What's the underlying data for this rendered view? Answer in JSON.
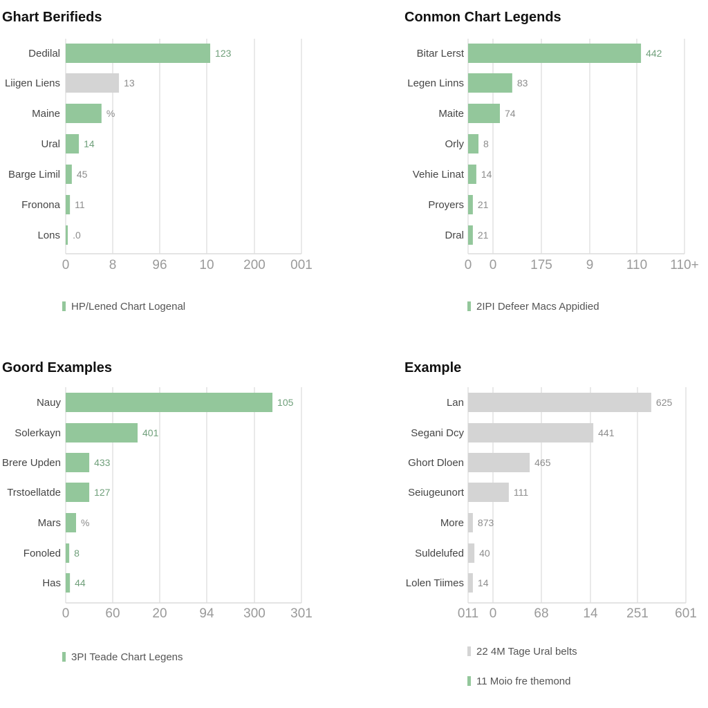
{
  "colors": {
    "green": "#93c79b",
    "grey": "#d4d4d4",
    "label_green": "#6f9f7a",
    "label_grey": "#8c8c8c"
  },
  "chart_data": [
    {
      "type": "bar",
      "orientation": "horizontal",
      "title": "Ghart Berifieds",
      "categories": [
        "Dedilal",
        "Liigen Liens",
        "Maine",
        "Ural",
        "Barge Limil",
        "Fronona",
        "Lons"
      ],
      "values": [
        0.613,
        0.226,
        0.152,
        0.056,
        0.026,
        0.018,
        0.009
      ],
      "value_units": "fraction of x-axis range",
      "data_labels": [
        "123",
        "13",
        "%",
        "14",
        "45",
        "11",
        ".0"
      ],
      "bar_colors": [
        "green",
        "grey",
        "green",
        "green",
        "green",
        "green",
        "green"
      ],
      "label_colors": [
        "green",
        "grey",
        "grey",
        "green",
        "grey",
        "grey",
        "grey"
      ],
      "xticks": [
        "0",
        "8",
        "96",
        "10",
        "200",
        "001"
      ],
      "xlabel": "",
      "ylabel": "",
      "grid": true,
      "legend_position": "bottom-left",
      "legend": [
        {
          "label": "HP/Lened Chart Logenal",
          "color": "green"
        }
      ]
    },
    {
      "type": "bar",
      "orientation": "horizontal",
      "title": "Conmon Chart Legends",
      "categories": [
        "Bitar Lerst",
        "Legen Linns",
        "Maite",
        "Orly",
        "Vehie Linat",
        "Proyers",
        "Dral"
      ],
      "values": [
        0.799,
        0.204,
        0.147,
        0.048,
        0.038,
        0.022,
        0.022
      ],
      "value_units": "fraction of x-axis range",
      "data_labels": [
        "442",
        "83",
        "74",
        "8",
        "14",
        "21",
        "21"
      ],
      "bar_colors": [
        "green",
        "green",
        "green",
        "green",
        "green",
        "green",
        "green"
      ],
      "label_colors": [
        "green",
        "grey",
        "grey",
        "grey",
        "grey",
        "grey",
        "grey"
      ],
      "xticks": [
        "0",
        "0",
        "175",
        "9",
        "110",
        "110+"
      ],
      "xlabel": "",
      "ylabel": "",
      "grid": true,
      "legend_position": "bottom-left",
      "legend": [
        {
          "label": "2IPI Defeer Macs Appidied",
          "color": "green"
        }
      ]
    },
    {
      "type": "bar",
      "orientation": "horizontal",
      "title": "Goord Examples",
      "categories": [
        "Nauy",
        "Solerkayn",
        "Brere Upden",
        "Trstoellatde",
        "Mars",
        "Fonoled",
        "Has"
      ],
      "values": [
        0.877,
        0.305,
        0.1,
        0.1,
        0.044,
        0.015,
        0.018
      ],
      "value_units": "fraction of x-axis range",
      "data_labels": [
        "105",
        "401",
        "433",
        "127",
        "%",
        "8",
        "44"
      ],
      "bar_colors": [
        "green",
        "green",
        "green",
        "green",
        "green",
        "green",
        "green"
      ],
      "label_colors": [
        "green",
        "green",
        "green",
        "green",
        "grey",
        "green",
        "green"
      ],
      "xticks": [
        "0",
        "60",
        "20",
        "94",
        "300",
        "301"
      ],
      "xlabel": "",
      "ylabel": "",
      "grid": true,
      "legend_position": "bottom-left",
      "legend": [
        {
          "label": "3PI Teade Chart Legens",
          "color": "green"
        }
      ]
    },
    {
      "type": "bar",
      "orientation": "horizontal",
      "title": "Example",
      "categories": [
        "Lan",
        "Segani Dcy",
        "Ghort Dloen",
        "Seiugeunort",
        "More",
        "Suldelufed",
        "Lolen Tiimes"
      ],
      "values": [
        0.841,
        0.575,
        0.283,
        0.187,
        0.022,
        0.029,
        0.022
      ],
      "value_units": "fraction of x-axis range",
      "data_labels": [
        "625",
        "441",
        "465",
        "111",
        "873",
        "40",
        "14"
      ],
      "bar_colors": [
        "grey",
        "grey",
        "grey",
        "grey",
        "grey",
        "grey",
        "grey"
      ],
      "label_colors": [
        "grey",
        "grey",
        "grey",
        "grey",
        "grey",
        "grey",
        "grey"
      ],
      "xticks": [
        "011",
        "0",
        "68",
        "14",
        "251",
        "601"
      ],
      "xlabel": "",
      "ylabel": "",
      "grid": true,
      "legend_position": "bottom-left",
      "legend": [
        {
          "label": "22 4M Tage Ural belts",
          "color": "grey"
        },
        {
          "label": "11 Moio fre themond",
          "color": "green"
        }
      ]
    }
  ]
}
